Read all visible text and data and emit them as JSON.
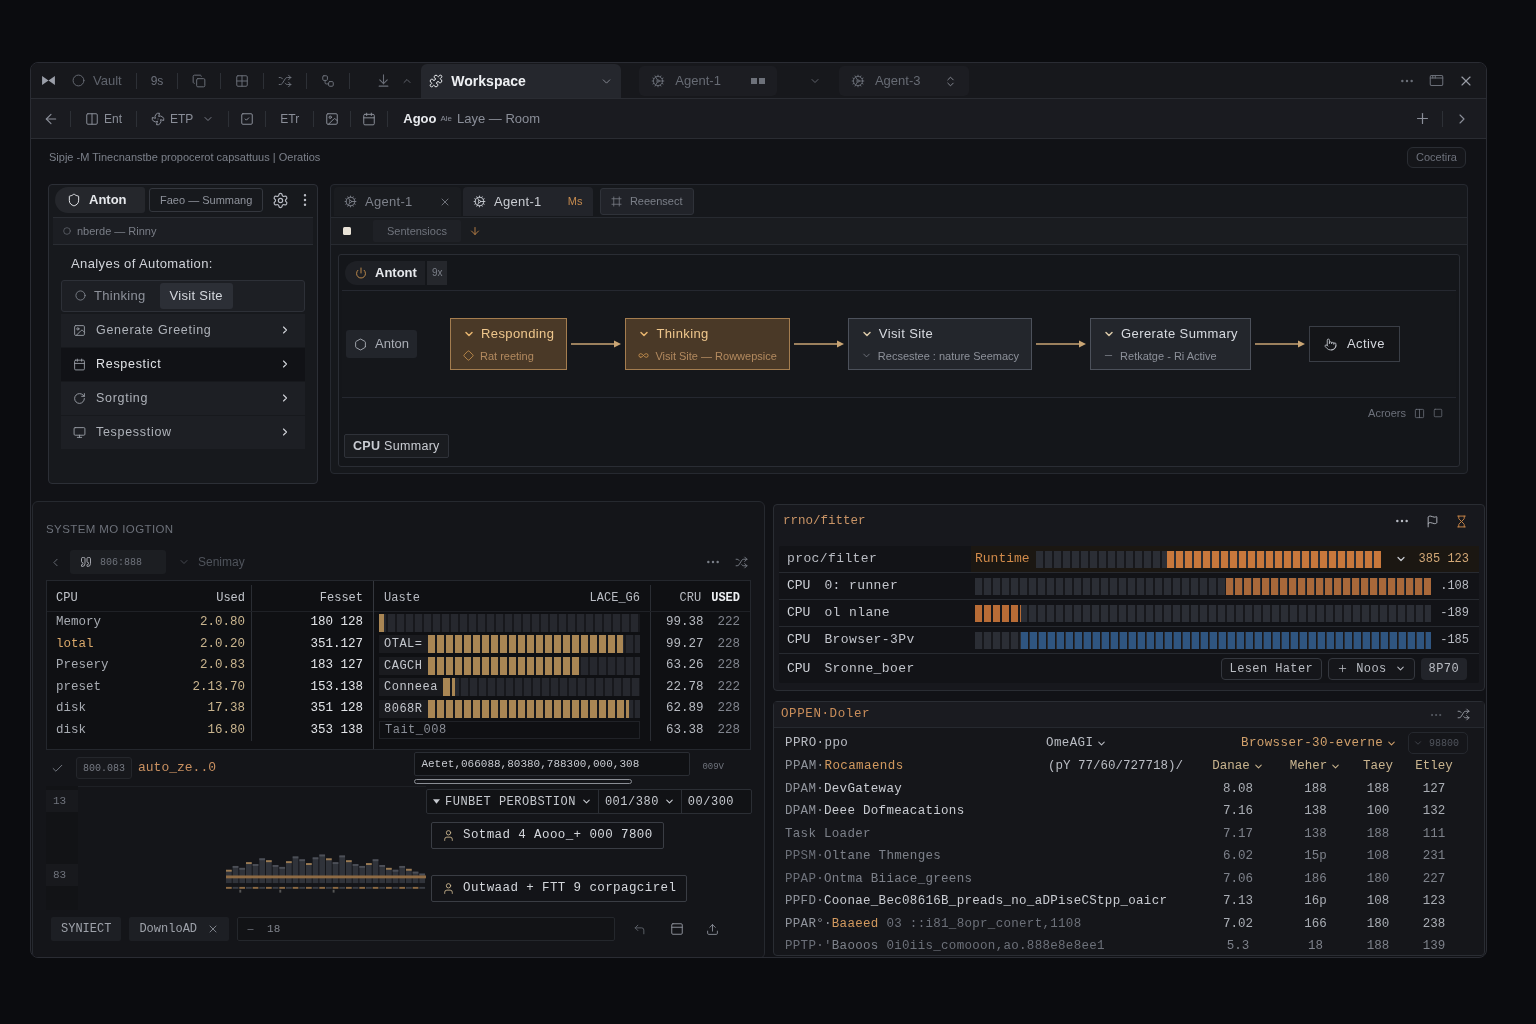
{
  "titlebar": {
    "app": "Vault",
    "counter": "9s",
    "tabs": [
      {
        "label": "Workspace",
        "selected": true
      },
      {
        "label": "Agent-1",
        "selected": false
      },
      {
        "label": "Agent-3",
        "selected": false
      }
    ]
  },
  "toolbar": {
    "buttons": [
      {
        "label": "Ent",
        "kind": "button"
      },
      {
        "label": "ETP",
        "kind": "menu"
      },
      {
        "label": "ETr",
        "kind": "button"
      }
    ],
    "breadcrumb": {
      "title": "Agoo",
      "tag": "Ale",
      "path": "Laye — Room"
    }
  },
  "status": {
    "text": "Sipje -M Tinecnanstbe propocerot capsattuus | Oeratios",
    "action": "Cocetira"
  },
  "agent_panel": {
    "tab": "Anton",
    "subtitle": "Faeo — Summang",
    "filter": "nberde — Rinny",
    "heading": "Analyes of Automation:",
    "modes": [
      {
        "label": "Thinking",
        "selected": false
      },
      {
        "label": "Visit Site",
        "selected": true
      }
    ],
    "items": [
      {
        "label": "Generate Greeting",
        "selected": false
      },
      {
        "label": "Respestict",
        "selected": true
      },
      {
        "label": "Sorgting",
        "selected": false
      },
      {
        "label": "Tespesstiow",
        "selected": false
      }
    ]
  },
  "workflow": {
    "tabs": [
      {
        "label": "Agent-1",
        "selected": false
      },
      {
        "label": "Agent-1",
        "badge": "Ms",
        "selected": true
      }
    ],
    "action": "Reeensect",
    "section": "Sentensiocs",
    "chip": {
      "label": "Antont",
      "count": "9x"
    },
    "nodes": [
      {
        "kind": "start",
        "title": "Anton",
        "highlighted": false
      },
      {
        "kind": "step",
        "title": "Responding",
        "detail": "Rat reeting",
        "highlighted": true
      },
      {
        "kind": "step",
        "title": "Thinking",
        "detail": "Visit Site — Rowwepsice",
        "highlighted": true
      },
      {
        "kind": "step",
        "title": "Visit Site",
        "detail": "Recsestee : nature Seemacy",
        "highlighted": false
      },
      {
        "kind": "step",
        "title": "Gererate Summary",
        "detail": "Retkatge - Ri Active",
        "highlighted": false
      },
      {
        "kind": "end",
        "title": "Active",
        "highlighted": false
      }
    ],
    "footer": "Acroers",
    "summary_button": "**CPU** Summary"
  },
  "monitor": {
    "title": "SYSTEM MO IOGTION",
    "chip": "806:888",
    "view": "Senimay",
    "usage_table": {
      "columns": [
        "CPU",
        "Used",
        "Fesset"
      ],
      "rows": [
        {
          "name": "Memory",
          "used": "2.0.80",
          "reset": "180 128",
          "accent": false
        },
        {
          "name": "lotal",
          "used": "2.0.20",
          "reset": "351.127",
          "accent": true
        },
        {
          "name": "Presery",
          "used": "2.0.83",
          "reset": "183 127",
          "accent": false
        },
        {
          "name": "preset",
          "used": "2.13.70",
          "reset": "153.138",
          "accent": false
        },
        {
          "name": "disk",
          "used": "17.38",
          "reset": "351 128",
          "accent": false
        },
        {
          "name": "disk",
          "used": "16.80",
          "reset": "353 138",
          "accent": false
        }
      ]
    },
    "cache_table": {
      "columns": [
        "Uaste",
        "LACE_G6",
        "CRU",
        "USED"
      ],
      "rows": [
        {
          "kind": "bar",
          "level": 0.02,
          "cru": "99.38",
          "used": "222"
        },
        {
          "kind": "bar",
          "label": "OTAL=",
          "level": 0.92,
          "cru": "99.27",
          "used": "228"
        },
        {
          "kind": "bar",
          "label": "CAGCH",
          "level": 0.72,
          "cru": "63.26",
          "used": "228"
        },
        {
          "kind": "bar",
          "label": "Conneea",
          "level": 0.06,
          "cru": "22.78",
          "used": "222"
        },
        {
          "kind": "bar",
          "label": "8068R",
          "level": 0.95,
          "cru": "62.89",
          "used": "228"
        },
        {
          "kind": "text",
          "label": "Tait_008",
          "cru": "63.38",
          "used": "228"
        }
      ]
    },
    "value_field": "800.083",
    "value_label": "auto_ze..0",
    "query_field": "Aetet,066088,80380,788300,000,308",
    "query_unit": "009V",
    "chart_axis": [
      "13",
      "83"
    ],
    "selectors": [
      {
        "label": "FUNBET PEROBSTION",
        "kind": "menu"
      },
      {
        "label": "001/380",
        "kind": "menu"
      },
      {
        "label": "00/300",
        "kind": "plain"
      }
    ],
    "actions": [
      "Sotmad 4 Aooo_+ 000 7800",
      "Outwaad + FTT 9 corpagcirel"
    ],
    "footer": {
      "buttons": [
        "SYNIECT",
        "DownloAD"
      ],
      "field": "18"
    }
  },
  "filter_panel": {
    "title": "rrno/fitter",
    "header": {
      "label": "proc/filter",
      "bar_label": "Runtime",
      "kind": "right",
      "level": 0.62,
      "color": "#c8783c",
      "value": "385 123"
    },
    "rows": [
      {
        "tag": "CPU",
        "name": "0: runner",
        "kind": "right",
        "level": 0.45,
        "color": "#a8683a",
        "value": ".108"
      },
      {
        "tag": "CPU",
        "name": "ol nlane",
        "kind": "left",
        "level": 0.1,
        "color": "#b86c36",
        "value": "-189"
      },
      {
        "tag": "CPU",
        "name": "Browser-3Pv",
        "kind": "right",
        "level": 0.9,
        "color": "#2f5580",
        "value": "-185"
      }
    ],
    "last_row": {
      "tag": "CPU",
      "name": "Sronne_boer"
    },
    "buttons": [
      {
        "label": "Lesen Hater",
        "kind": "button"
      },
      {
        "label": "Noos",
        "kind": "menu"
      },
      {
        "label": "8P70",
        "kind": "tag"
      }
    ]
  },
  "process_panel": {
    "title": "OPPEN·Doler",
    "filters": [
      {
        "label": "PPRO·ppo",
        "kind": "text",
        "accent": false
      },
      {
        "label": "OmeAGI",
        "kind": "menu",
        "accent": false
      },
      {
        "label": "Browsser-30-everne",
        "kind": "menu",
        "accent": true
      },
      {
        "label": "98800",
        "kind": "field",
        "accent": false
      }
    ],
    "group": {
      "prefix": "PPAM·",
      "name": "Rocamaends",
      "range": "(pY 77/60/727718)/"
    },
    "columns": [
      {
        "label": "Danae",
        "sortable": true
      },
      {
        "label": "Meher",
        "sortable": true
      },
      {
        "label": "Taey",
        "sortable": false
      },
      {
        "label": "Etley",
        "sortable": false
      }
    ],
    "rows": [
      {
        "prefix": "DPAM·",
        "name": "DevGateway",
        "kind": "normal",
        "values": [
          "8.08",
          "188",
          "188",
          "127"
        ]
      },
      {
        "prefix": "DPAM·",
        "name": "Deee Dofmeacations",
        "kind": "normal",
        "values": [
          "7.16",
          "138",
          "100",
          "132"
        ]
      },
      {
        "name": "Task Loader",
        "kind": "dim",
        "values": [
          "7.17",
          "138",
          "188",
          "111"
        ]
      },
      {
        "prefix": "PPSM·",
        "name": "Oltane Thmenges",
        "kind": "dim",
        "values": [
          "6.02",
          "15p",
          "108",
          "231"
        ]
      },
      {
        "prefix": "PPAP·",
        "name": "Ontma Biiace_greens",
        "kind": "dim",
        "values": [
          "7.06",
          "186",
          "180",
          "227"
        ]
      },
      {
        "prefix": "PPFD·",
        "name": "Coonae_Bec08616B_preads_no_aDPiseCStpp_oaicr",
        "kind": "normal",
        "values": [
          "7.13",
          "16p",
          "108",
          "123"
        ]
      },
      {
        "prefix": "PPAR°·",
        "name": "Baaeed",
        "note": "03 ::i81_8opr_conert,1108",
        "kind": "accent",
        "values": [
          "7.02",
          "166",
          "180",
          "238"
        ]
      },
      {
        "prefix": "PPTP·'",
        "name": "Baooos",
        "note": "0i0iis_comooon,ao.888e8e8ee1",
        "kind": "dim",
        "values": [
          "5.3",
          "18",
          "188",
          "139"
        ]
      }
    ]
  }
}
